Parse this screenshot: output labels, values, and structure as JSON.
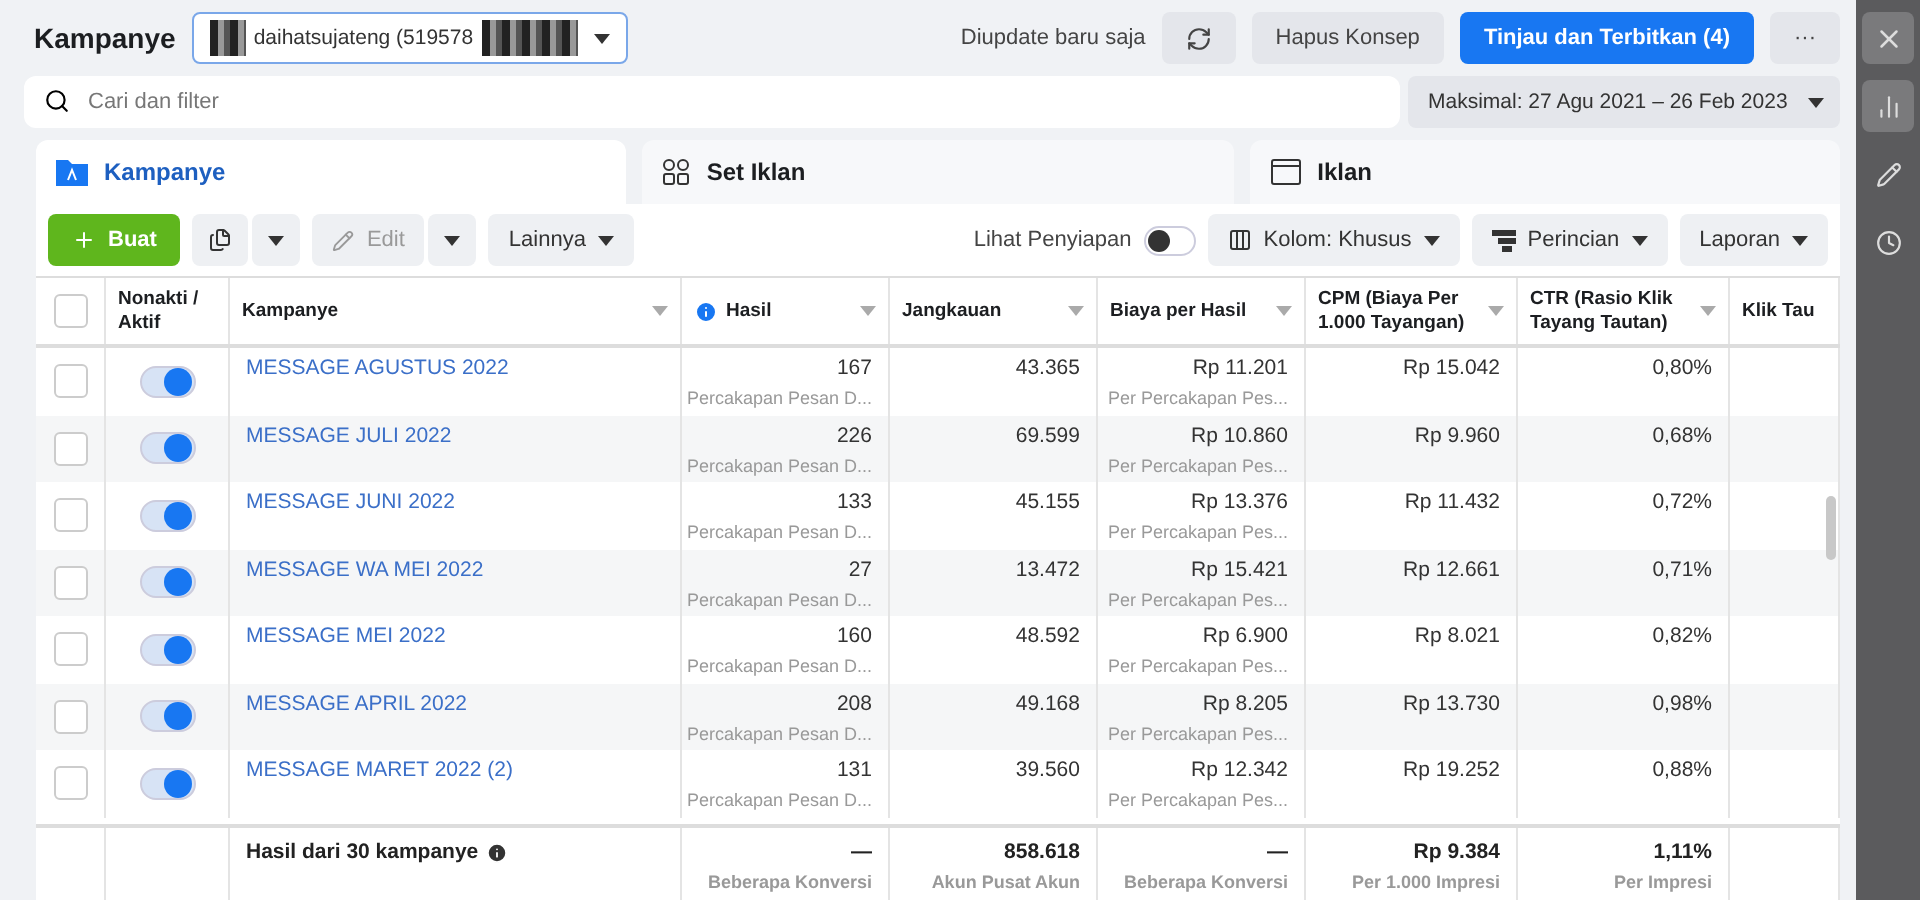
{
  "header": {
    "title": "Kampanye",
    "account": "daihatsujateng (519578",
    "status": "Diupdate baru saja",
    "discard": "Hapus Konsep",
    "publish": "Tinjau dan Terbitkan (4)",
    "more": "···"
  },
  "search": {
    "placeholder": "Cari dan filter"
  },
  "date_range": "Maksimal: 27 Agu 2021 – 26 Feb 2023",
  "tabs": [
    {
      "label": "Kampanye",
      "selected": true,
      "kind": "campaign"
    },
    {
      "label": "Set Iklan",
      "selected": false,
      "kind": "adset"
    },
    {
      "label": "Iklan",
      "selected": false,
      "kind": "ad"
    }
  ],
  "toolbar": {
    "create": "Buat",
    "edit": "Edit",
    "more": "Lainnya",
    "preview_label": "Lihat Penyiapan",
    "preview_on": false,
    "columns": "Kolom: Khusus",
    "breakdown": "Perincian",
    "reports": "Laporan"
  },
  "table": {
    "select_all_checked": false,
    "columns": [
      {
        "label": "Nonakti / Aktif"
      },
      {
        "label": "Kampanye"
      },
      {
        "label": "Hasil",
        "info": true
      },
      {
        "label": "Jangkauan"
      },
      {
        "label": "Biaya per Hasil"
      },
      {
        "label": "CPM (Biaya Per 1.000 Tayangan)"
      },
      {
        "label": "CTR (Rasio Klik Tayang Tautan)"
      },
      {
        "label": "Klik Tau"
      }
    ],
    "rows": [
      {
        "checked": false,
        "active": true,
        "name": "MESSAGE AGUSTUS 2022",
        "result": "167",
        "result_type": "Percakapan Pesan D...",
        "reach": "43.365",
        "cost": "Rp 11.201",
        "cost_type": "Per Percakapan Pes...",
        "cpm": "Rp 15.042",
        "ctr": "0,80%"
      },
      {
        "checked": false,
        "active": true,
        "name": "MESSAGE JULI 2022",
        "result": "226",
        "result_type": "Percakapan Pesan D...",
        "reach": "69.599",
        "cost": "Rp 10.860",
        "cost_type": "Per Percakapan Pes...",
        "cpm": "Rp 9.960",
        "ctr": "0,68%"
      },
      {
        "checked": false,
        "active": true,
        "name": "MESSAGE JUNI 2022",
        "result": "133",
        "result_type": "Percakapan Pesan D...",
        "reach": "45.155",
        "cost": "Rp 13.376",
        "cost_type": "Per Percakapan Pes...",
        "cpm": "Rp 11.432",
        "ctr": "0,72%"
      },
      {
        "checked": false,
        "active": true,
        "name": "MESSAGE WA MEI 2022",
        "result": "27",
        "result_type": "Percakapan Pesan D...",
        "reach": "13.472",
        "cost": "Rp 15.421",
        "cost_type": "Per Percakapan Pes...",
        "cpm": "Rp 12.661",
        "ctr": "0,71%"
      },
      {
        "checked": false,
        "active": true,
        "name": "MESSAGE MEI 2022",
        "result": "160",
        "result_type": "Percakapan Pesan D...",
        "reach": "48.592",
        "cost": "Rp 6.900",
        "cost_type": "Per Percakapan Pes...",
        "cpm": "Rp 8.021",
        "ctr": "0,82%"
      },
      {
        "checked": false,
        "active": true,
        "name": "MESSAGE APRIL 2022",
        "result": "208",
        "result_type": "Percakapan Pesan D...",
        "reach": "49.168",
        "cost": "Rp 8.205",
        "cost_type": "Per Percakapan Pes...",
        "cpm": "Rp 13.730",
        "ctr": "0,98%"
      },
      {
        "checked": false,
        "active": true,
        "name": "MESSAGE MARET 2022 (2)",
        "result": "131",
        "result_type": "Percakapan Pesan D...",
        "reach": "39.560",
        "cost": "Rp 12.342",
        "cost_type": "Per Percakapan Pes...",
        "cpm": "Rp 19.252",
        "ctr": "0,88%"
      }
    ],
    "totals": {
      "label": "Hasil dari 30 kampanye",
      "result": "—",
      "result_note": "Beberapa Konversi",
      "reach": "858.618",
      "reach_note": "Akun Pusat Akun",
      "cost": "—",
      "cost_note": "Beberapa Konversi",
      "cpm": "Rp 9.384",
      "cpm_note": "Per 1.000 Impresi",
      "ctr": "1,11%",
      "ctr_note": "Per Impresi"
    }
  }
}
